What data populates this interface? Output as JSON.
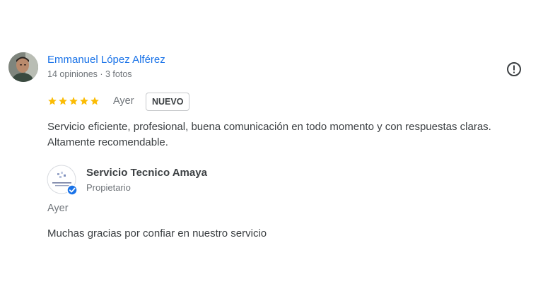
{
  "review": {
    "reviewer_name": "Emmanuel López Alférez",
    "reviewer_meta": "14 opiniones · 3 fotos",
    "rating": 5,
    "rating_max": 5,
    "date": "Ayer",
    "badge": "NUEVO",
    "text": "Servicio eficiente, profesional, buena comunicación en todo momento y con respuestas claras. Altamente recomendable."
  },
  "owner_reply": {
    "name": "Servicio Tecnico Amaya",
    "role": "Propietario",
    "date": "Ayer",
    "text": "Muchas gracias por confiar en nuestro servicio",
    "logo_text": "Servicio Tecnico Amaya"
  },
  "icons": {
    "flag": "report-flag-icon",
    "star": "star-icon",
    "verified": "verified-badge-icon"
  },
  "colors": {
    "name_link": "#1a73e8",
    "star": "#fbbc04",
    "secondary_text": "#70757a",
    "verified": "#1a73e8"
  }
}
